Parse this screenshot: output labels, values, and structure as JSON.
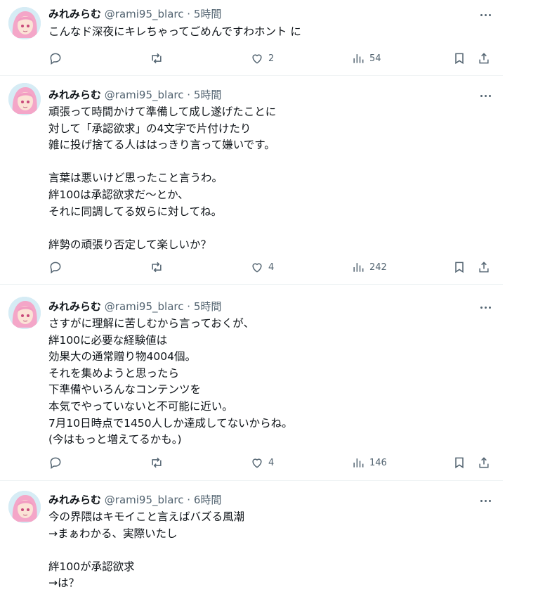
{
  "tweets": [
    {
      "name": "みれみらむ",
      "handle": "@rami95_blarc",
      "separator": "·",
      "time": "5時間",
      "lines": [
        "こんなド深夜にキレちゃってごめんですわホント に"
      ],
      "replies": "",
      "retweets": "",
      "likes": "2",
      "views": "54"
    },
    {
      "name": "みれみらむ",
      "handle": "@rami95_blarc",
      "separator": "·",
      "time": "5時間",
      "lines": [
        "頑張って時間かけて準備して成し遂げたことに",
        "対して「承認欲求」の4文字で片付けたり",
        "雑に投げ捨てる人ははっきり言って嫌いです。",
        "",
        "言葉は悪いけど思ったこと言うわ。",
        "絆100は承認欲求だ〜とか、",
        "それに同調してる奴らに対してね。",
        "",
        "絆勢の頑張り否定して楽しいか？"
      ],
      "replies": "",
      "retweets": "",
      "likes": "4",
      "views": "242"
    },
    {
      "name": "みれみらむ",
      "handle": "@rami95_blarc",
      "separator": "·",
      "time": "5時間",
      "lines": [
        "さすがに理解に苦しむから言っておくが、",
        "絆100に必要な経験値は",
        "効果大の通常贈り物4004個。",
        "それを集めようと思ったら",
        "下準備やいろんなコンテンツを",
        "本気でやっていないと不可能に近い。",
        "7月10日時点で1450人しか達成してないからね。",
        "(今はもっと増えてるかも。)"
      ],
      "replies": "",
      "retweets": "",
      "likes": "4",
      "views": "146"
    },
    {
      "name": "みれみらむ",
      "handle": "@rami95_blarc",
      "separator": "·",
      "time": "6時間",
      "lines": [
        "今の界隈はキモイこと言えばバズる風潮",
        "→まぁわかる、実際いたし",
        "",
        "絆100が承認欲求",
        "→は？"
      ],
      "replies": "",
      "retweets": "",
      "likes": "",
      "views": ""
    }
  ],
  "icons": {
    "reply": "reply-icon",
    "retweet": "retweet-icon",
    "like": "heart-icon",
    "views": "views-icon",
    "bookmark": "bookmark-icon",
    "share": "share-icon",
    "more": "more-icon"
  },
  "colors": {
    "text": "#0f1419",
    "secondary": "#536471",
    "divider": "#eff3f4"
  }
}
